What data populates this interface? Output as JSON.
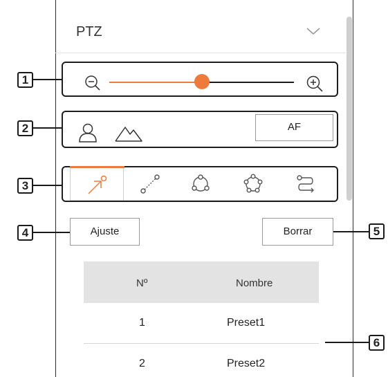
{
  "ptz": {
    "title": "PTZ",
    "zoom_slider_value_pct": 50,
    "af_label": "AF",
    "tabs": [
      {
        "icon": "preset-arrow-icon",
        "active": true
      },
      {
        "icon": "swing-icon",
        "active": false
      },
      {
        "icon": "group-icon",
        "active": false
      },
      {
        "icon": "tour-icon",
        "active": false
      },
      {
        "icon": "trace-icon",
        "active": false
      }
    ],
    "adjust_label": "Ajuste",
    "delete_label": "Borrar",
    "table": {
      "headers": [
        "Nº",
        "Nombre"
      ],
      "rows": [
        {
          "no": "1",
          "name": "Preset1"
        },
        {
          "no": "2",
          "name": "Preset2"
        }
      ]
    }
  },
  "callouts": [
    "1",
    "2",
    "3",
    "4",
    "5",
    "6"
  ],
  "colors": {
    "accent": "#ee7b3b",
    "border": "#1d1d1d",
    "table_header": "#e3e3e3"
  }
}
